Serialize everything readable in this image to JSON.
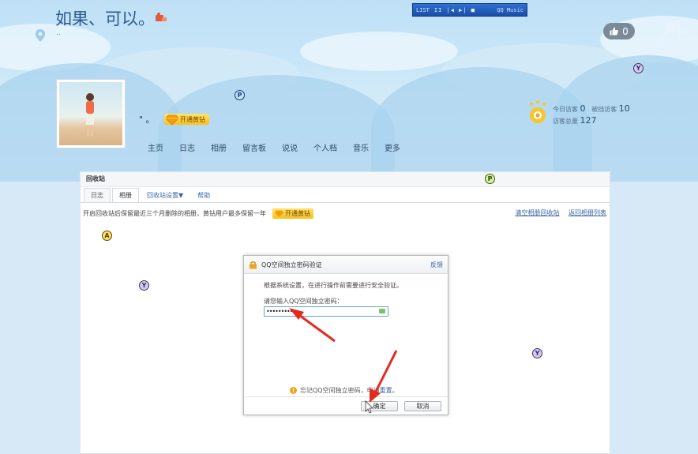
{
  "header": {
    "title": "如果、可以。",
    "subtitle": "..",
    "like_count": "0"
  },
  "music_player": {
    "list_label": "LIST",
    "controls": "II |◀ ▶| ■",
    "name": "QQ Music"
  },
  "profile": {
    "quote": "\" 。",
    "vip_button": "开通黄钻"
  },
  "nav": {
    "items": [
      "主页",
      "日志",
      "相册",
      "留言板",
      "说说",
      "个人档",
      "音乐",
      "更多"
    ]
  },
  "visitors": {
    "today_label": "今日访客",
    "today_value": "0",
    "blocked_label": "被挡访客",
    "blocked_value": "10",
    "total_label": "访客总量",
    "total_value": "127"
  },
  "panel": {
    "title": "回收站",
    "tabs": [
      "日志",
      "相册",
      "回收站设置▼",
      "帮助"
    ],
    "notice": "开启回收站后保留最近三个月删除的相册，黄钻用户最多保留一年",
    "vip_button": "开通黄钻",
    "link_clear": "清空相册回收站",
    "link_back": "返回相册列表"
  },
  "dialog": {
    "title": "QQ空间独立密码验证",
    "feedback": "反馈",
    "body": "根据系统设置，在进行操作前需要进行安全验证。",
    "label": "请您输入QQ空间独立密码：",
    "password_mask": "•••••••••••",
    "forgot_text": "忘记QQ空间独立密码，",
    "forgot_apply": "申请",
    "reset": "重置。",
    "confirm": "确定",
    "cancel": "取消"
  },
  "badges": {
    "y": "Y",
    "p": "P",
    "a": "A"
  },
  "colors": {
    "sky": "#c8e6f8",
    "accent_link": "#3a67a8",
    "vip_yellow": "#f7c21b",
    "annotation_arrow": "#e5291f"
  }
}
